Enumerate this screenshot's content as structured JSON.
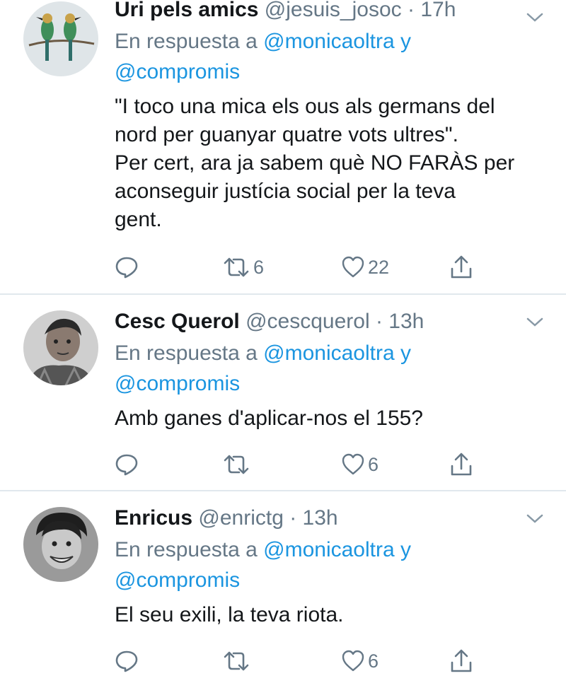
{
  "tweets": [
    {
      "name": "Uri pels amics",
      "handle": "@jesuis_josoc",
      "time": "· 17h",
      "reply_prefix": "En respuesta a",
      "reply_user1": "@monicaoltra",
      "reply_and": "y",
      "reply_user2": "@compromis",
      "lines": [
        "\"I toco una mica els ous als germans del",
        "nord per guanyar quatre vots ultres\".",
        "Per cert, ara ja sabem què NO FARÀS per",
        "aconseguir justícia social per la teva",
        "gent."
      ],
      "retweets": "6",
      "likes": "22",
      "avatar_icon": "bee-eater-birds-avatar"
    },
    {
      "name": "Cesc Querol",
      "handle": "@cescquerol",
      "time": "· 13h",
      "reply_prefix": "En respuesta a",
      "reply_user1": "@monicaoltra",
      "reply_and": "y",
      "reply_user2": "@compromis",
      "lines": [
        "Amb ganes d'aplicar-nos el 155?"
      ],
      "retweets": "",
      "likes": "6",
      "avatar_icon": "man-portrait-avatar"
    },
    {
      "name": "Enricus",
      "handle": "@enrictg",
      "time": "· 13h",
      "reply_prefix": "En respuesta a",
      "reply_user1": "@monicaoltra",
      "reply_and": "y",
      "reply_user2": "@compromis",
      "lines": [
        "El seu exili, la teva riota."
      ],
      "retweets": "",
      "likes": "6",
      "avatar_icon": "grinning-man-avatar"
    }
  ],
  "colors": {
    "text": "#14171a",
    "secondary": "#657786",
    "link": "#1b95e0",
    "divider": "#e1e8ed"
  }
}
